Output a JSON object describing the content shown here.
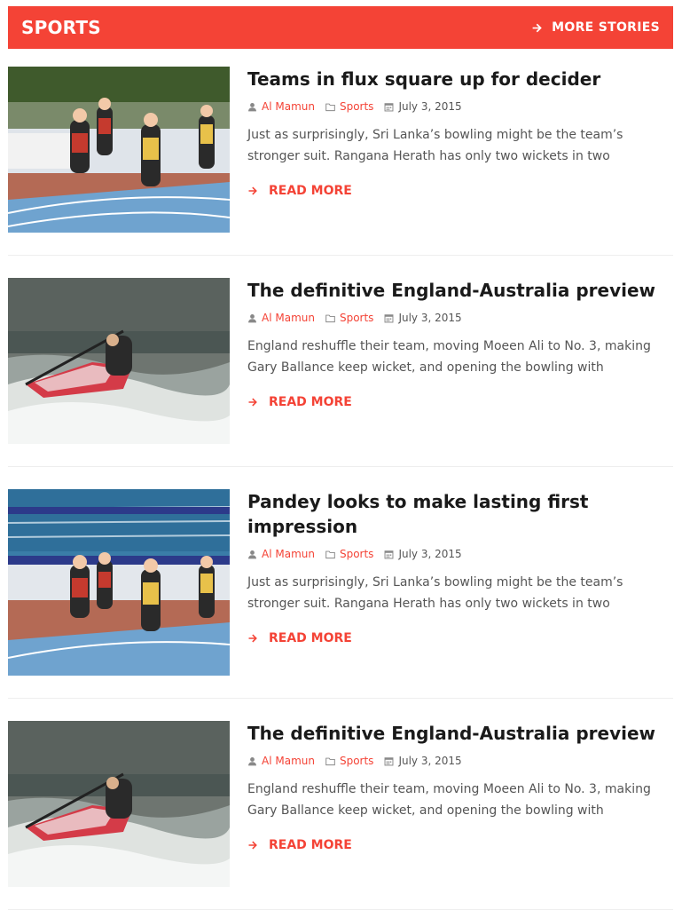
{
  "header": {
    "title": "SPORTS",
    "more_label": "MORE STORIES"
  },
  "colors": {
    "accent": "#f44336"
  },
  "articles": [
    {
      "title": "Teams in flux square up for decider",
      "author": "Al Mamun",
      "category": "Sports",
      "date": "July 3, 2015",
      "excerpt": "Just as surprisingly, Sri Lanka’s bowling might be the team’s stronger suit. Rangana Herath has only two wickets in two",
      "read_more": "READ MORE"
    },
    {
      "title": "The definitive England-Australia preview",
      "author": "Al Mamun",
      "category": "Sports",
      "date": "July 3, 2015",
      "excerpt": "England reshuffle their team, moving Moeen Ali to No. 3, making Gary Ballance keep wicket, and opening the bowling with",
      "read_more": "READ MORE"
    },
    {
      "title": "Pandey looks to make lasting first impression",
      "author": "Al Mamun",
      "category": "Sports",
      "date": "July 3, 2015",
      "excerpt": "Just as surprisingly, Sri Lanka’s bowling might be the team’s stronger suit. Rangana Herath has only two wickets in two",
      "read_more": "READ MORE"
    },
    {
      "title": "The definitive England-Australia preview",
      "author": "Al Mamun",
      "category": "Sports",
      "date": "July 3, 2015",
      "excerpt": "England reshuffle their team, moving Moeen Ali to No. 3, making Gary Ballance keep wicket, and opening the bowling with",
      "read_more": "READ MORE"
    }
  ]
}
